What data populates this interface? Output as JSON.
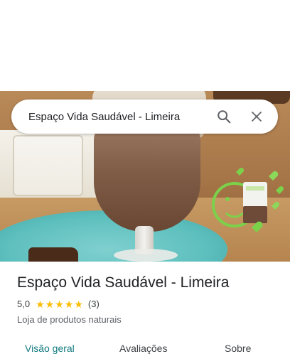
{
  "search": {
    "query": "Espaço Vida Saudável - Limeira"
  },
  "icons": {
    "search": "search-icon",
    "close": "close-icon"
  },
  "place": {
    "name": "Espaço Vida Saudável - Limeira",
    "rating": "5,0",
    "stars": 5,
    "review_count": "(3)",
    "category": "Loja de produtos naturais"
  },
  "tabs": [
    {
      "label": "Visão geral",
      "active": true
    },
    {
      "label": "Avaliações",
      "active": false
    },
    {
      "label": "Sobre",
      "active": false
    }
  ],
  "colors": {
    "accent": "#137a7f",
    "star": "#fbbc04"
  }
}
